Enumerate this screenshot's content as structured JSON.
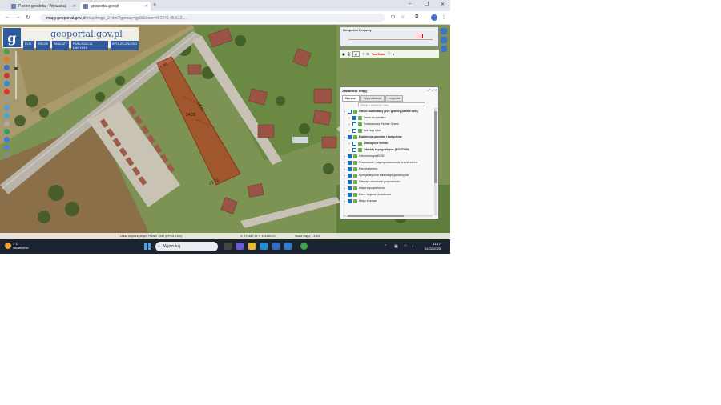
{
  "browser": {
    "tabs": [
      {
        "label": "Poster geodeta - Wyszukaj",
        "active": false
      },
      {
        "label": "geoportal.gov.pl",
        "active": true
      }
    ],
    "url_host": "mapy.geoportal.gov.pl",
    "url_path": "/imap/Imgp_2.html?gpmap=gp0&bbox=481642,45,612,..."
  },
  "site": {
    "logo_letter": "g",
    "logo_text": "geoportal.gov.pl",
    "menu": [
      "PLIK",
      "WIDOK",
      "ANALIZY",
      "PUBLIKACJA DANYCH",
      "SPOLECZNOSCI"
    ]
  },
  "map": {
    "parcel_dimensions": [
      "21.38",
      "14.41",
      "24.25",
      "21.62"
    ],
    "minimap_title": "Geoportal Krajowy",
    "toolbar_select": "pl",
    "toolbar_youtube": "YouTube"
  },
  "panel": {
    "title": "Zawartość mapy",
    "tabs": [
      "Warstwy",
      "Wyszukiwanie",
      "Legenda"
    ],
    "search_placeholder": "Szukaj w zawartości mapy",
    "layers": [
      {
        "name": "Obręb budowlany przy granicy pasów dróg",
        "bold": true,
        "checked": false,
        "indent": false
      },
      {
        "name": "Dane do pomiaru",
        "bold": false,
        "checked": true,
        "indent": true
      },
      {
        "name": "Podstawowy Rejestr Granic",
        "bold": false,
        "checked": false,
        "indent": true
      },
      {
        "name": "Adresy i ulice",
        "bold": false,
        "checked": false,
        "indent": true
      },
      {
        "name": "Ewidencja gruntów i budynków",
        "bold": true,
        "checked": true,
        "indent": false
      },
      {
        "name": "Uzbrojenie terenu",
        "bold": true,
        "checked": false,
        "indent": true
      },
      {
        "name": "Obiekty topograficzne (BDOT500)",
        "bold": true,
        "checked": false,
        "indent": true
      },
      {
        "name": "Ortofotomapa ECW",
        "bold": false,
        "checked": true,
        "indent": false
      },
      {
        "name": "Planowanie i zagospodarowanie przestrzenne",
        "bold": false,
        "checked": true,
        "indent": false
      },
      {
        "name": "Rzeźba terenu",
        "bold": false,
        "checked": true,
        "indent": false
      },
      {
        "name": "Specjalistyczna informacja geodezyjna",
        "bold": false,
        "checked": true,
        "indent": false
      },
      {
        "name": "Obszary chronione przyrodniczo",
        "bold": false,
        "checked": true,
        "indent": false
      },
      {
        "name": "Mapa topograficzna",
        "bold": false,
        "checked": true,
        "indent": false
      },
      {
        "name": "Dane krajowe dodatkowe",
        "bold": false,
        "checked": true,
        "indent": false
      },
      {
        "name": "Mapy bazowe",
        "bold": false,
        "checked": true,
        "indent": false
      }
    ]
  },
  "statusbar": {
    "left": "Układ współrzędnych PUWG 1992 (EPSG:2180)",
    "coords": "X: 575487.39  Y: 424189.23",
    "scale": "Skala mapy: 1:1000"
  },
  "taskbar": {
    "weather_temp": "3°C",
    "weather_desc": "Słonecznie",
    "search_placeholder": "Wyszukaj",
    "time": "11:17",
    "date": "13.02.2025"
  },
  "colors": {
    "parcel_fill": "#b0401f",
    "accent": "#2e5a9c"
  }
}
